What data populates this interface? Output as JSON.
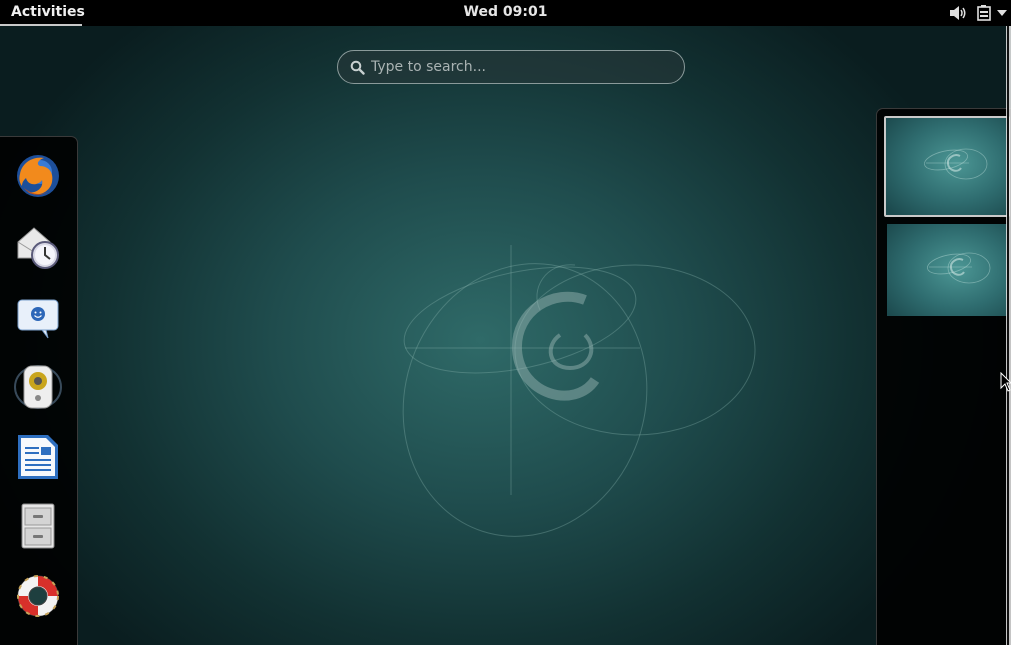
{
  "topbar": {
    "activities_label": "Activities",
    "clock_label": "Wed 09:01",
    "volume_icon": "speaker-volume-icon",
    "battery_icon": "battery-icon",
    "menu_icon": "chevron-down-icon"
  },
  "search": {
    "placeholder": "Type to search...",
    "icon": "search-icon"
  },
  "dash": {
    "items": [
      {
        "app": "Firefox",
        "icon": "firefox-icon"
      },
      {
        "app": "Evolution",
        "icon": "mail-clock-icon"
      },
      {
        "app": "Empathy",
        "icon": "chat-bubble-icon"
      },
      {
        "app": "Rhythmbox",
        "icon": "speaker-icon"
      },
      {
        "app": "LibreOffice Writer",
        "icon": "document-icon"
      },
      {
        "app": "Files",
        "icon": "file-cabinet-icon"
      },
      {
        "app": "Help",
        "icon": "lifebuoy-icon"
      }
    ]
  },
  "workspaces": {
    "count": 2,
    "active_index": 0
  },
  "colors": {
    "background_center": "#2f6a68",
    "background_edge": "#0a1d1f",
    "panel": "#000000",
    "text": "#e6e6e6",
    "firefox_orange": "#f28a1c",
    "writer_blue": "#2e6fc0",
    "lifebuoy_red": "#d8302a"
  }
}
